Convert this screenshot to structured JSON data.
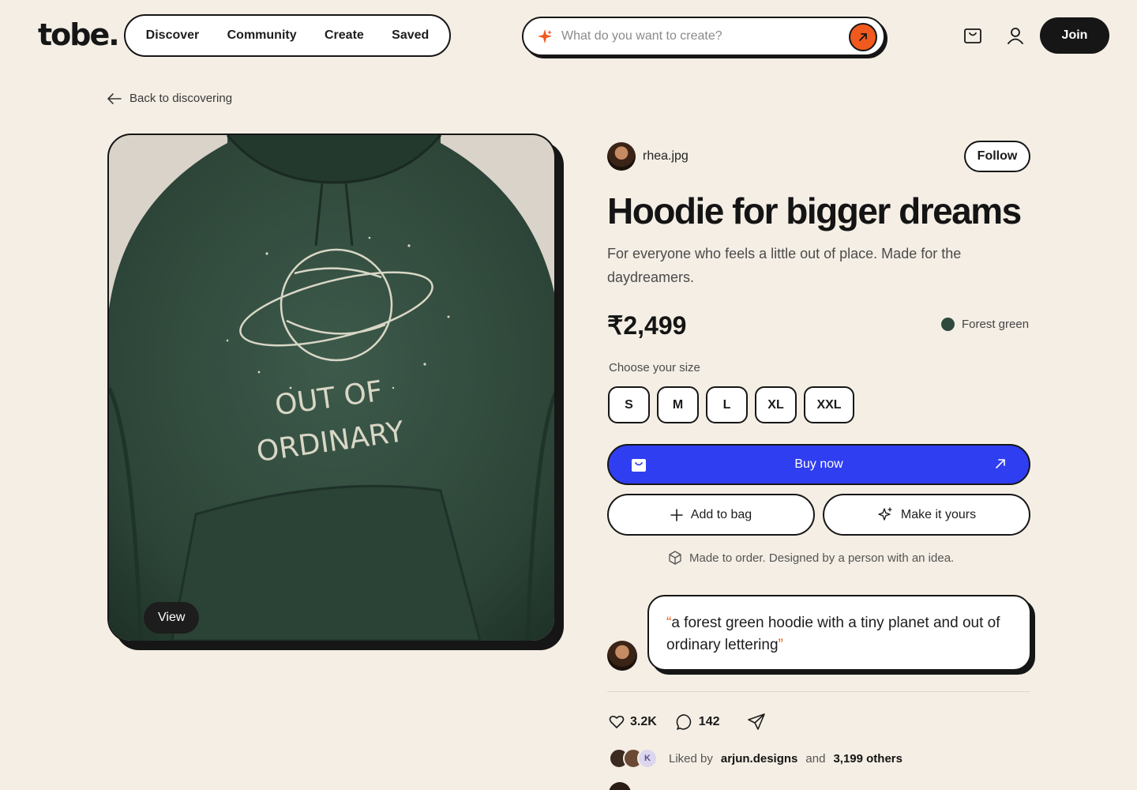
{
  "header": {
    "logo": "tobe.",
    "nav": [
      "Discover",
      "Community",
      "Create",
      "Saved"
    ],
    "search_placeholder": "What do you want to create?",
    "join_label": "Join"
  },
  "back_label": "Back to discovering",
  "image": {
    "print_line1": "OUT OF",
    "print_line2": "ORDINARY",
    "view_label": "View"
  },
  "product": {
    "creator": "rhea.jpg",
    "follow_label": "Follow",
    "title": "Hoodie for bigger dreams",
    "description": "For everyone who feels a little out of place. Made for the daydreamers.",
    "price": "₹2,499",
    "colour_name": "Forest green",
    "colour_hex": "#2f4a3d",
    "size_label": "Choose your size",
    "sizes": [
      "S",
      "M",
      "L",
      "XL",
      "XXL"
    ],
    "buy_label": "Buy now",
    "add_to_bag_label": "Add to bag",
    "make_it_yours_label": "Make it yours",
    "note": "Made to order. Designed by a person with an idea."
  },
  "prompt": {
    "open_quote": "“",
    "text": "a forest green hoodie with a tiny planet and out of ordinary lettering",
    "close_quote": "”"
  },
  "social": {
    "likes": "3.2K",
    "comments": "142",
    "liked_prefix": "Liked by",
    "liked_user": "arjun.designs",
    "liked_and": "and",
    "liked_others": "3,199 others",
    "avatar_initial": "K"
  },
  "colors": {
    "accent_orange": "#f05a1e",
    "buy_blue": "#2f3ef0",
    "background": "#f4eee4"
  }
}
